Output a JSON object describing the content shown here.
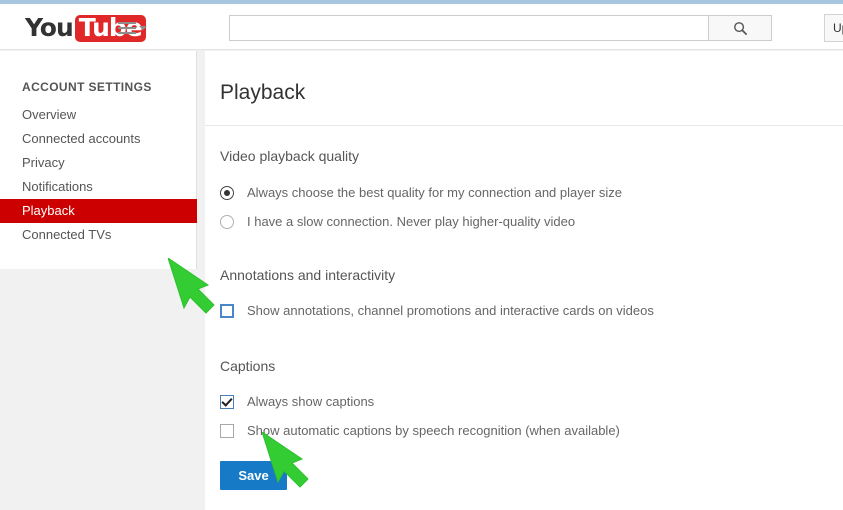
{
  "masthead": {
    "logo_you": "You",
    "logo_tube": "Tube",
    "menu_icon": "hamburger-menu-icon",
    "search": {
      "value": "",
      "placeholder": "",
      "button_icon": "search-icon"
    },
    "upload_label": "Upload"
  },
  "sidebar": {
    "title": "ACCOUNT SETTINGS",
    "items": [
      {
        "label": "Overview",
        "active": false
      },
      {
        "label": "Connected accounts",
        "active": false
      },
      {
        "label": "Privacy",
        "active": false
      },
      {
        "label": "Notifications",
        "active": false
      },
      {
        "label": "Playback",
        "active": true
      },
      {
        "label": "Connected TVs",
        "active": false
      }
    ],
    "active_color": "#cc0000"
  },
  "main": {
    "page_title": "Playback",
    "sections": {
      "quality": {
        "heading": "Video playback quality",
        "options": [
          {
            "label": "Always choose the best quality for my connection and player size",
            "selected": true
          },
          {
            "label": "I have a slow connection. Never play higher-quality video",
            "selected": false
          }
        ]
      },
      "annotations": {
        "heading": "Annotations and interactivity",
        "options": [
          {
            "label": "Show annotations, channel promotions and interactive cards on videos",
            "checked": false,
            "focused": true
          }
        ]
      },
      "captions": {
        "heading": "Captions",
        "options": [
          {
            "label": "Always show captions",
            "checked": true,
            "focused": false
          },
          {
            "label": "Show automatic captions by speech recognition (when available)",
            "checked": false,
            "focused": false
          }
        ]
      }
    },
    "save_label": "Save"
  },
  "annotations_overlay": {
    "arrow_color": "#33cc33",
    "arrows": [
      {
        "name": "arrow-pointing-to-annotations-checkbox",
        "direction": "down-right"
      },
      {
        "name": "arrow-pointing-to-save-button",
        "direction": "down-left"
      }
    ]
  }
}
